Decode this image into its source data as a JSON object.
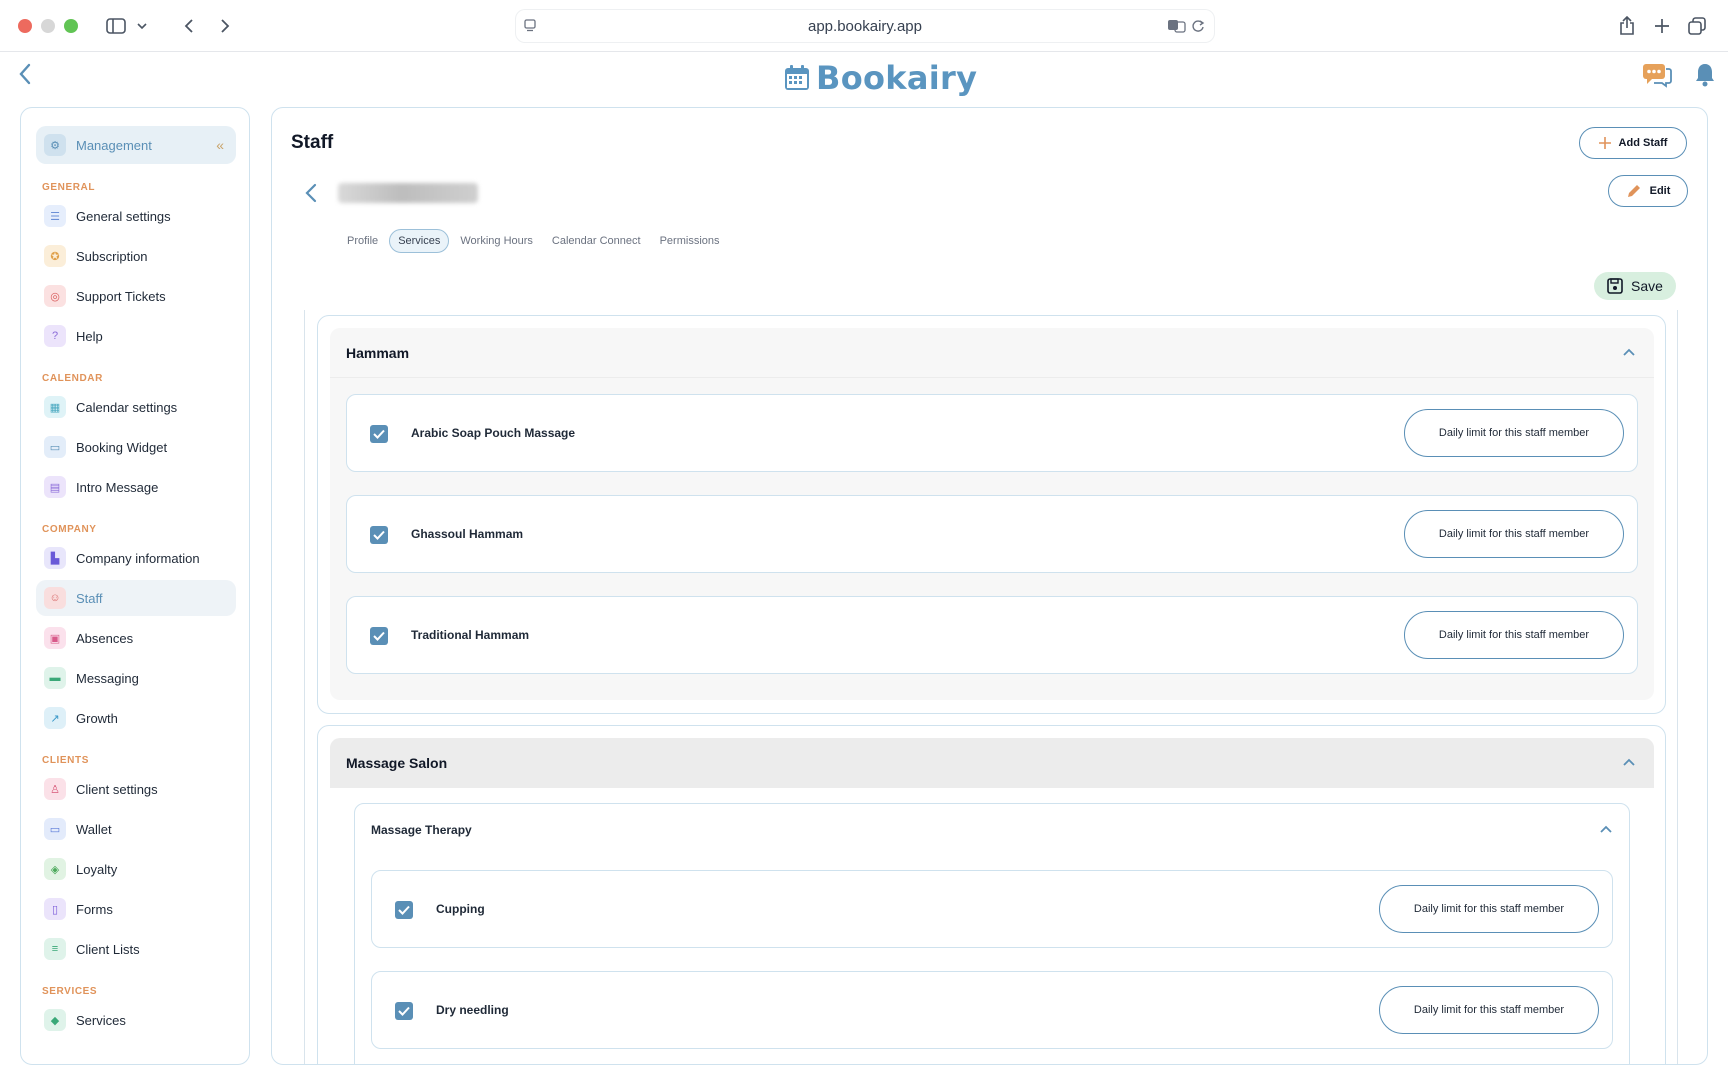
{
  "browser": {
    "url": "app.bookairy.app"
  },
  "app": {
    "brand": "Bookairy",
    "brand_color": "#5a95c0"
  },
  "sidebar": {
    "header": "Management",
    "sections": [
      {
        "title": "GENERAL",
        "items": [
          {
            "label": "General settings",
            "icon": "sliders-icon"
          },
          {
            "label": "Subscription",
            "icon": "badge-icon"
          },
          {
            "label": "Support Tickets",
            "icon": "lifebuoy-icon"
          },
          {
            "label": "Help",
            "icon": "question-icon"
          }
        ]
      },
      {
        "title": "CALENDAR",
        "items": [
          {
            "label": "Calendar settings",
            "icon": "calendar-icon"
          },
          {
            "label": "Booking Widget",
            "icon": "widget-icon"
          },
          {
            "label": "Intro Message",
            "icon": "message-icon"
          }
        ]
      },
      {
        "title": "COMPANY",
        "items": [
          {
            "label": "Company information",
            "icon": "building-icon"
          },
          {
            "label": "Staff",
            "icon": "people-icon",
            "active": true
          },
          {
            "label": "Absences",
            "icon": "calendar-off-icon"
          },
          {
            "label": "Messaging",
            "icon": "chat-icon"
          },
          {
            "label": "Growth",
            "icon": "trend-icon"
          }
        ]
      },
      {
        "title": "CLIENTS",
        "items": [
          {
            "label": "Client settings",
            "icon": "user-icon"
          },
          {
            "label": "Wallet",
            "icon": "wallet-icon"
          },
          {
            "label": "Loyalty",
            "icon": "tag-icon"
          },
          {
            "label": "Forms",
            "icon": "document-icon"
          },
          {
            "label": "Client Lists",
            "icon": "list-icon"
          }
        ]
      },
      {
        "title": "SERVICES",
        "items": [
          {
            "label": "Services",
            "icon": "diamond-icon"
          }
        ]
      }
    ]
  },
  "main": {
    "title": "Staff",
    "add_staff_label": "Add Staff",
    "edit_label": "Edit",
    "save_label": "Save",
    "tabs": [
      {
        "label": "Profile",
        "active": false
      },
      {
        "label": "Services",
        "active": true
      },
      {
        "label": "Working Hours",
        "active": false
      },
      {
        "label": "Calendar Connect",
        "active": false
      },
      {
        "label": "Permissions",
        "active": false
      }
    ],
    "limit_label": "Daily limit for this staff member",
    "categories": [
      {
        "name": "Hammam",
        "services": [
          {
            "name": "Arabic Soap Pouch Massage",
            "checked": true
          },
          {
            "name": "Ghassoul Hammam",
            "checked": true
          },
          {
            "name": "Traditional Hammam",
            "checked": true
          }
        ]
      },
      {
        "name": "Massage Salon",
        "subcategory": {
          "name": "Massage Therapy",
          "services": [
            {
              "name": "Cupping",
              "checked": true
            },
            {
              "name": "Dry needling",
              "checked": true
            }
          ]
        }
      }
    ]
  }
}
